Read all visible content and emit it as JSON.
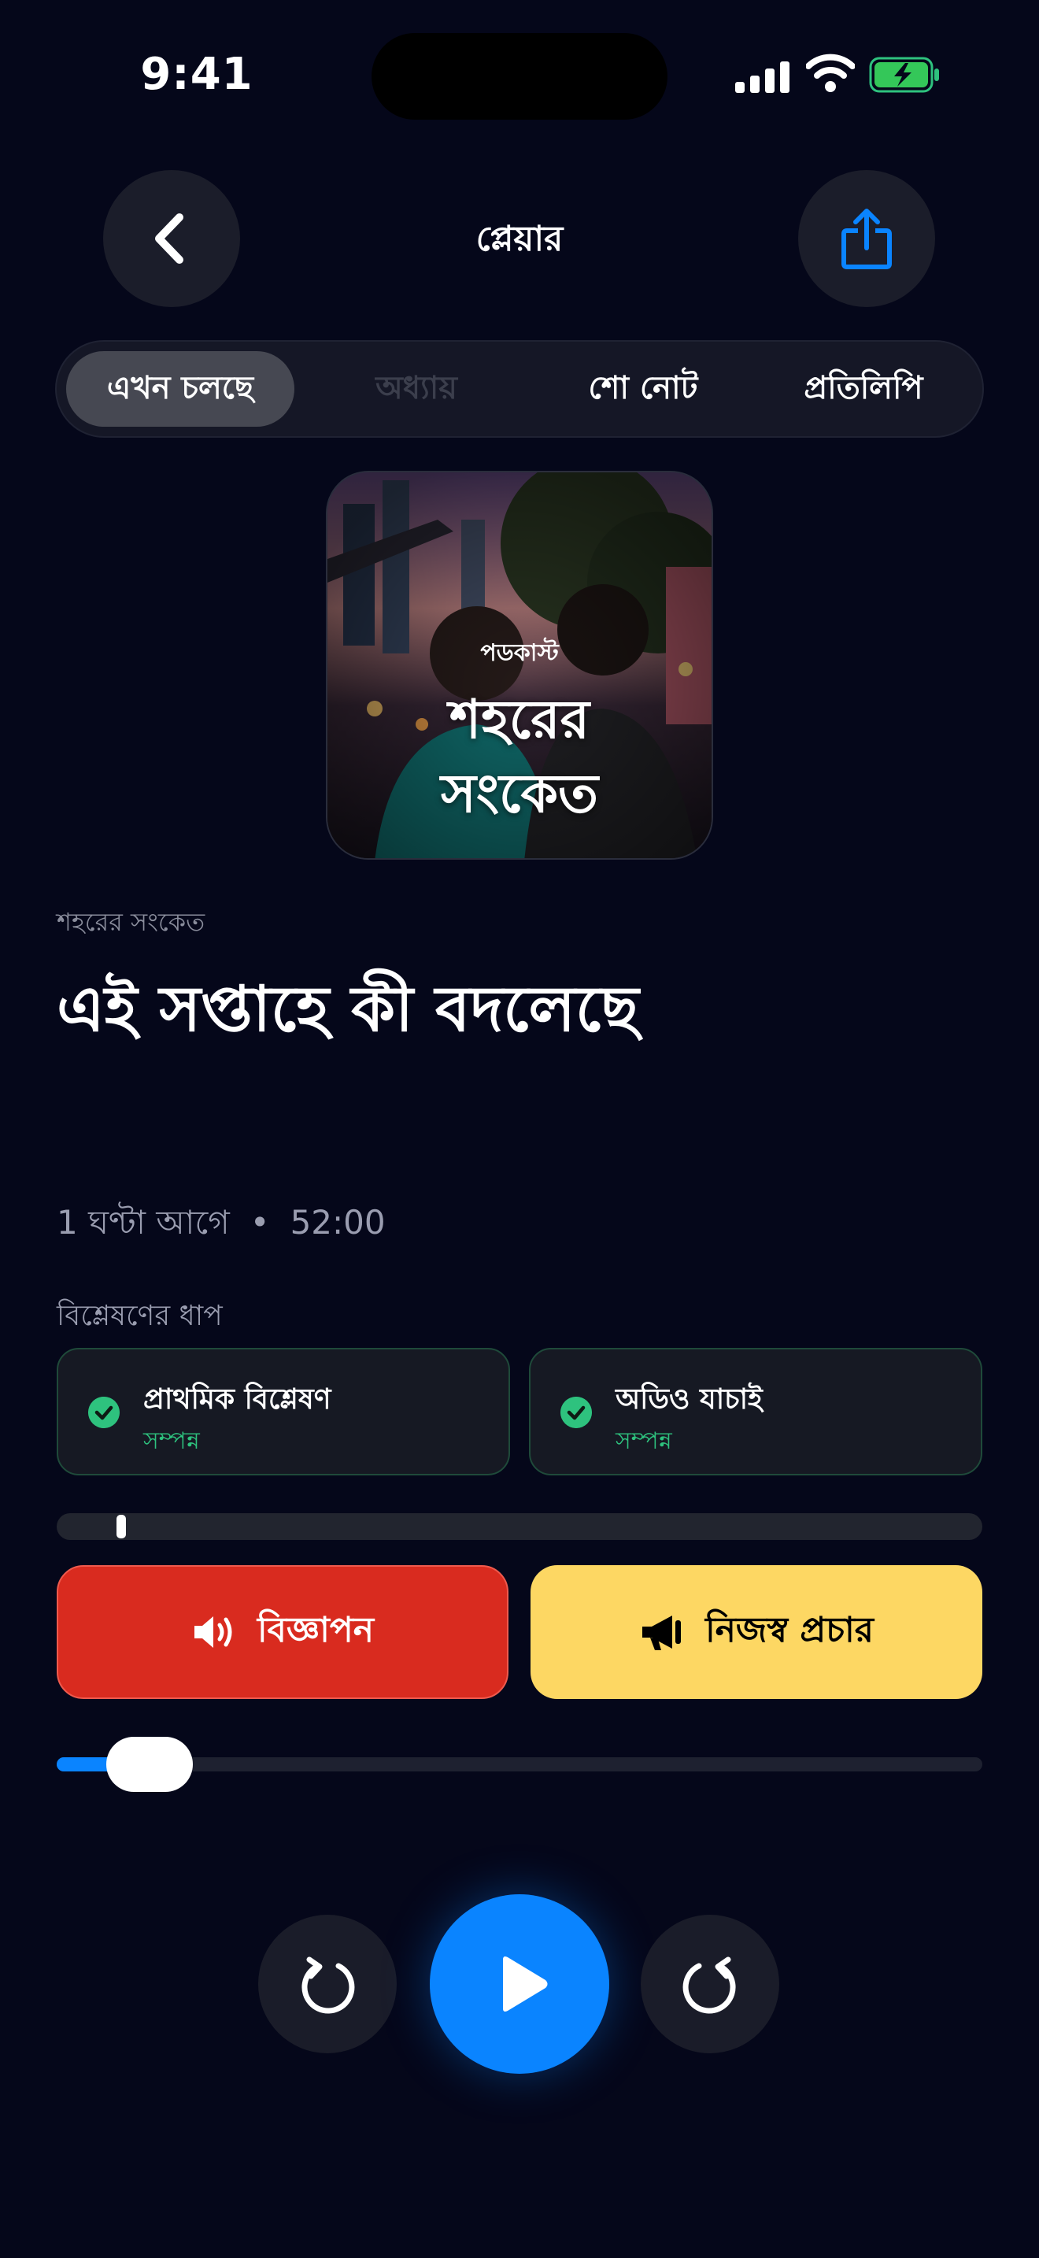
{
  "status_bar": {
    "time": "9:41"
  },
  "header": {
    "title": "প্লেয়ার"
  },
  "tabs": [
    {
      "label": "এখন চলছে",
      "active": true
    },
    {
      "label": "অধ্যায়",
      "active": false,
      "disabled": true
    },
    {
      "label": "শো নোট",
      "active": false
    },
    {
      "label": "প্রতিলিপি",
      "active": false
    }
  ],
  "artwork": {
    "kicker": "পডকাস্ট",
    "title_line1": "শহরের",
    "title_line2": "সংকেত"
  },
  "episode": {
    "show_name": "শহরের সংকেত",
    "title": "এই সপ্তাহে কী বদলেছে",
    "published": "1 ঘণ্টা আগে",
    "separator": "•",
    "duration": "52:00"
  },
  "analysis": {
    "label": "বিশ্লেষণের ধাপ",
    "stages": [
      {
        "title": "প্রাথমিক বিশ্লেষণ",
        "status": "সম্পন্ন"
      },
      {
        "title": "অডিও যাচাই",
        "status": "সম্পন্ন"
      }
    ]
  },
  "buttons": {
    "ad": "বিজ্ঞাপন",
    "self_promo": "নিজস্ব প্রচার"
  },
  "playback": {
    "progress_fraction": 0.05
  },
  "colors": {
    "accent": "#0a84ff",
    "ad": "#d92b1f",
    "self_promo": "#fdd763",
    "success": "#2ec27e",
    "background": "#05071a"
  },
  "icons": {
    "back": "chevron-left-icon",
    "share": "share-icon",
    "ad": "speaker-icon",
    "self_promo": "megaphone-icon",
    "skip_back": "rotate-ccw-icon",
    "skip_forward": "rotate-cw-icon",
    "play": "play-icon"
  }
}
